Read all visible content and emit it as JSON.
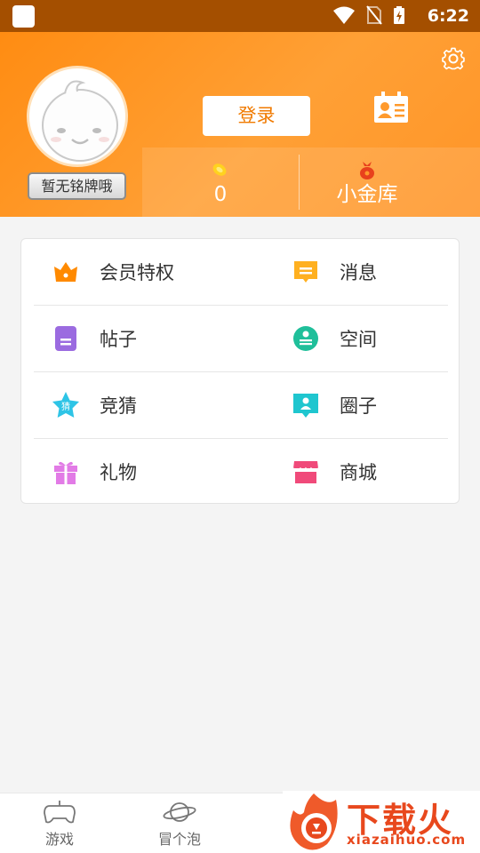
{
  "status_bar": {
    "time": "6:22"
  },
  "header": {
    "badge_label": "暂无铭牌哦",
    "login_label": "登录",
    "coins_value": "0",
    "vault_label": "小金库"
  },
  "menu": {
    "items": [
      {
        "label": "会员特权",
        "icon": "crown-icon",
        "color": "#ff8a00"
      },
      {
        "label": "消息",
        "icon": "message-icon",
        "color": "#ffb020"
      },
      {
        "label": "帖子",
        "icon": "post-icon",
        "color": "#9b6be0"
      },
      {
        "label": "空间",
        "icon": "space-icon",
        "color": "#1fbf9a"
      },
      {
        "label": "竞猜",
        "icon": "guess-icon",
        "color": "#2ec4e6",
        "icon_text": "猜"
      },
      {
        "label": "圈子",
        "icon": "circle-icon",
        "color": "#1fc6cf"
      },
      {
        "label": "礼物",
        "icon": "gift-icon",
        "color": "#e27be6"
      },
      {
        "label": "商城",
        "icon": "shop-icon",
        "color": "#f04a7a"
      }
    ]
  },
  "bottom_nav": {
    "items": [
      {
        "label": "游戏",
        "icon": "gamepad-icon"
      },
      {
        "label": "冒个泡",
        "icon": "planet-icon"
      }
    ]
  },
  "watermark": {
    "brand": "下载火",
    "domain": "xiazaihuo.com"
  }
}
